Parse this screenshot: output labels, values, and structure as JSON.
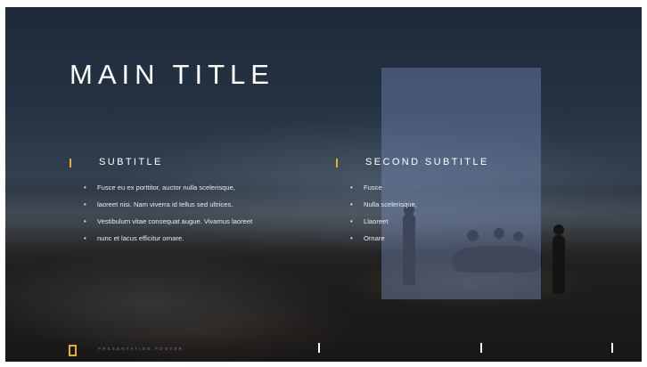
{
  "slide": {
    "title": "MAIN TITLE",
    "left_column": {
      "subtitle": "SUBTITLE",
      "bullets": [
        "Fusce eu ex porttitor, auctor nulla scelerisque,",
        "laoreet nisi. Nam viverra id tellus sed ultrices.",
        "Vestibulum vitae consequat augue. Vivamus laoreet",
        "nunc et lacus efficitur ornare."
      ]
    },
    "right_column": {
      "subtitle": "SECOND SUBTITLE",
      "bullets": [
        "Fusce",
        "Nulla scelerisque,",
        "Llaoreet",
        "Ornare"
      ]
    },
    "footer": {
      "text": "PRESENTATION FOOTER"
    }
  },
  "colors": {
    "accent": "#e5b022",
    "title_text": "#ffffff",
    "overlay": "#788cb9"
  },
  "icons": {
    "footer_logo": "yellow-rectangle-logo-icon",
    "subtitle_marker": "yellow-bar-icon",
    "bullet": "bullet-dot-icon"
  }
}
